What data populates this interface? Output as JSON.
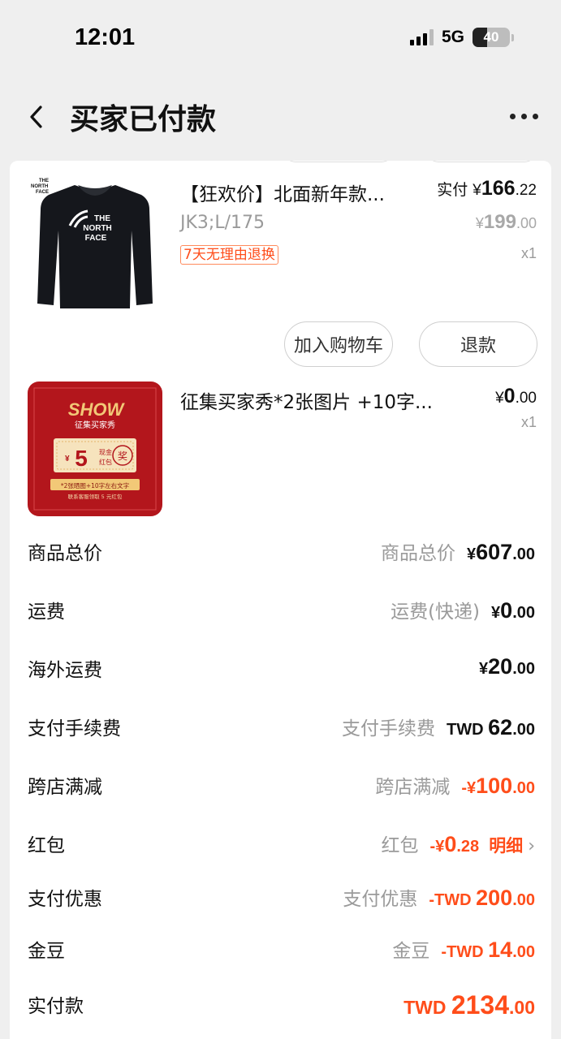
{
  "status_bar": {
    "time": "12:01",
    "network": "5G",
    "battery": "40"
  },
  "nav": {
    "title": "买家已付款"
  },
  "products": [
    {
      "title": "【狂欢价】北面新年款...",
      "spec": "JK3;L/175",
      "tag": "7天无理由退换",
      "paid_prefix": "实付",
      "paid_symbol": "¥",
      "paid_int": "166",
      "paid_dec": ".22",
      "orig_symbol": "¥",
      "orig_int": "199",
      "orig_dec": ".00",
      "qty": "x1",
      "brand_text": "THE NORTH FACE",
      "actions": [
        "加入购物车",
        "退款"
      ]
    },
    {
      "title": "征集买家秀*2张图片 +10字...",
      "paid_symbol": "¥",
      "paid_int": "0",
      "paid_dec": ".00",
      "qty": "x1",
      "promo": {
        "show": "SHOW",
        "subtitle": "征集买家秀",
        "currency": "¥",
        "amount": "5",
        "cash": "现金",
        "hongbao": "红包",
        "stamp": "奖",
        "note1": "*2张晒图+10字左右文字",
        "note2": "联系客服领取 5 元红包"
      }
    }
  ],
  "summary": {
    "goods_total": {
      "label": "商品总价",
      "sub": "商品总价",
      "cur": "¥",
      "int": "607",
      "dec": ".00"
    },
    "shipping": {
      "label": "运费",
      "sub": "运费(快递)",
      "cur": "¥",
      "int": "0",
      "dec": ".00"
    },
    "overseas_shipping": {
      "label": "海外运费",
      "cur": "¥",
      "int": "20",
      "dec": ".00"
    },
    "payment_fee": {
      "label": "支付手续费",
      "sub": "支付手续费",
      "cur": "TWD ",
      "int": "62",
      "dec": ".00"
    },
    "cross_store": {
      "label": "跨店满减",
      "sub": "跨店满减",
      "cur": "-¥",
      "int": "100",
      "dec": ".00"
    },
    "red_packet": {
      "label": "红包",
      "sub": "红包",
      "cur": "-¥",
      "int": "0",
      "dec": ".28",
      "link": "明细"
    },
    "pay_discount": {
      "label": "支付优惠",
      "sub": "支付优惠",
      "cur": "-TWD ",
      "int": "200",
      "dec": ".00"
    },
    "gold_bean": {
      "label": "金豆",
      "sub": "金豆",
      "cur": "-TWD ",
      "int": "14",
      "dec": ".00"
    },
    "actual_paid": {
      "label": "实付款",
      "cur": "TWD ",
      "int": "2134",
      "dec": ".00"
    }
  },
  "colors": {
    "accent": "#ff4d1a",
    "promo_red": "#b3161c",
    "gold": "#f2c877"
  }
}
